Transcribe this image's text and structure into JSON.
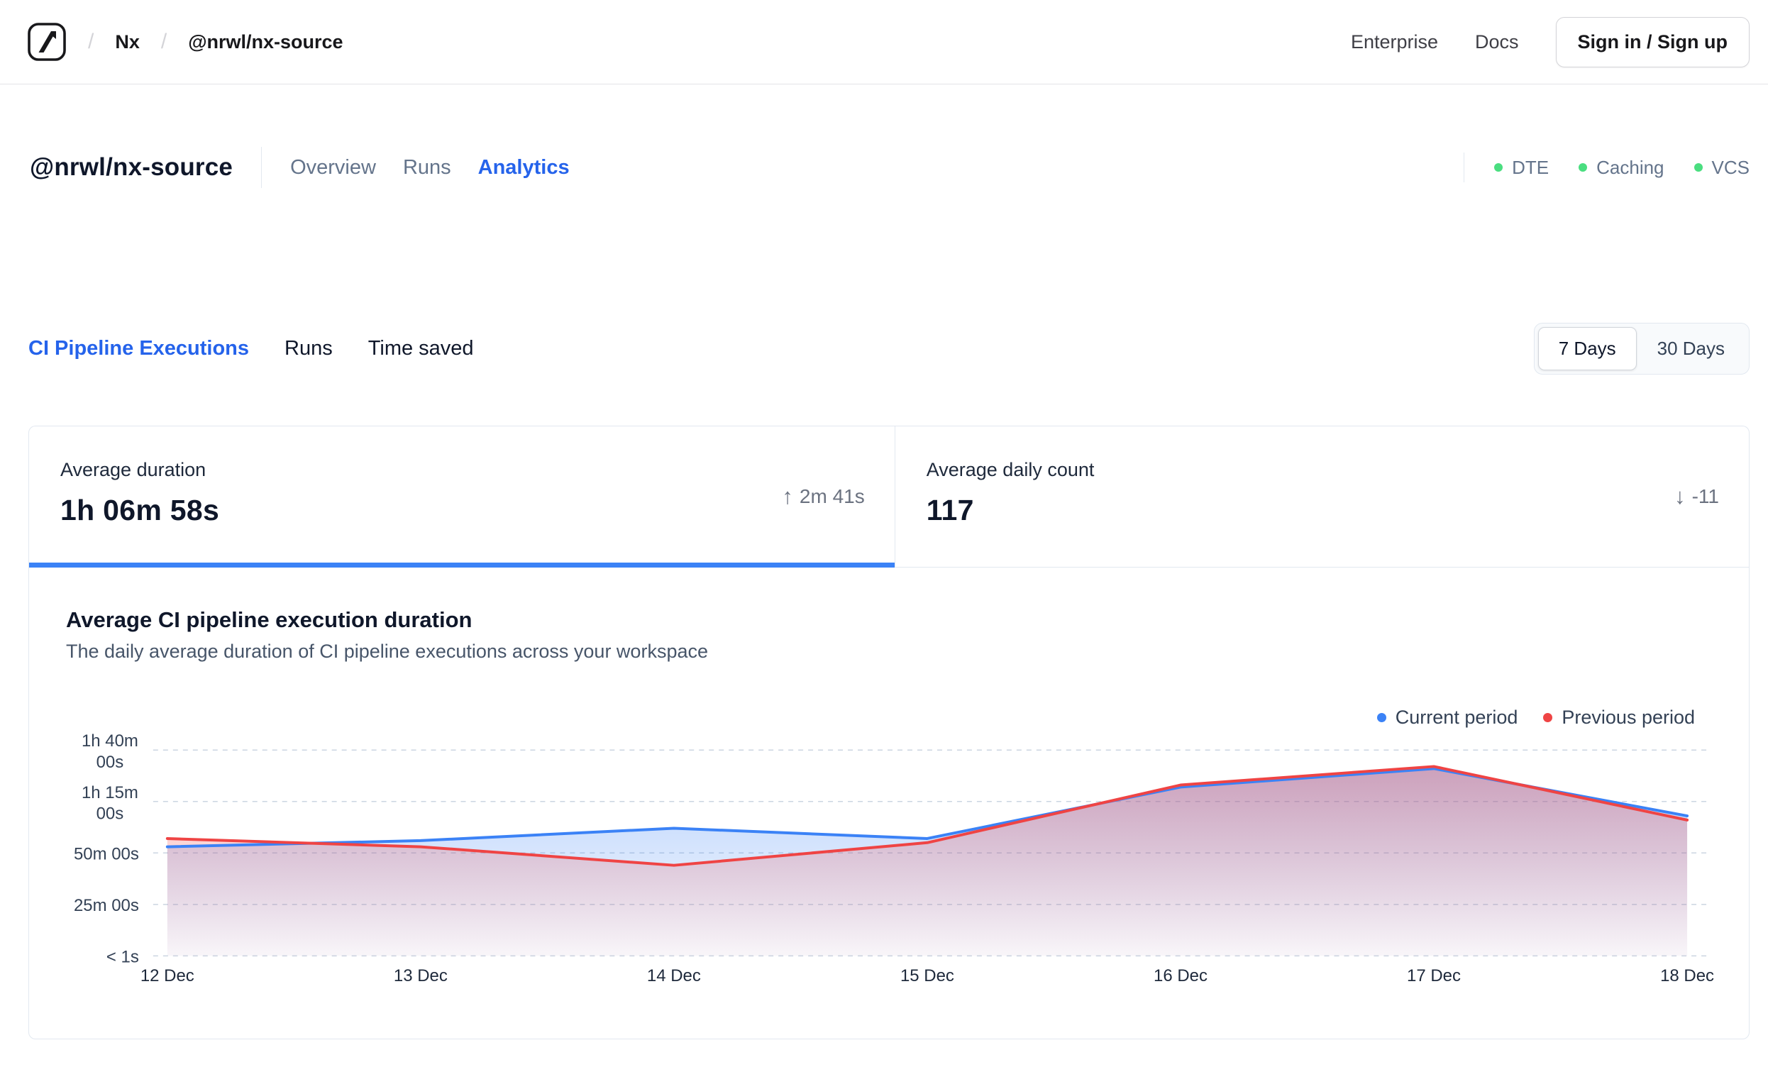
{
  "navbar": {
    "breadcrumb": {
      "separator": "/",
      "org": "Nx",
      "repo": "@nrwl/nx-source"
    },
    "links": {
      "enterprise": "Enterprise",
      "docs": "Docs"
    },
    "sign_in_button": "Sign in / Sign up"
  },
  "workspace_header": {
    "title": "@nrwl/nx-source",
    "tabs": [
      {
        "label": "Overview",
        "active": false
      },
      {
        "label": "Runs",
        "active": false
      },
      {
        "label": "Analytics",
        "active": true
      }
    ],
    "statuses": [
      {
        "label": "DTE"
      },
      {
        "label": "Caching"
      },
      {
        "label": "VCS"
      }
    ],
    "status_dot_color": "#4ade80"
  },
  "analytics_tabs": [
    {
      "label": "CI Pipeline Executions",
      "active": true
    },
    {
      "label": "Runs",
      "active": false
    },
    {
      "label": "Time saved",
      "active": false
    }
  ],
  "range_toggle": {
    "options": [
      {
        "label": "7 Days",
        "active": true
      },
      {
        "label": "30 Days",
        "active": false
      }
    ]
  },
  "stat_cards": [
    {
      "label": "Average duration",
      "value": "1h 06m 58s",
      "delta": "2m 41s",
      "delta_arrow": "↑",
      "delta_direction": "up",
      "active": true
    },
    {
      "label": "Average daily count",
      "value": "117",
      "delta": "-11",
      "delta_arrow": "↓",
      "delta_direction": "down",
      "active": false
    }
  ],
  "chart_card": {
    "title": "Average CI pipeline execution duration",
    "subtitle": "The daily average duration of CI pipeline executions across your workspace"
  },
  "chart_data": {
    "type": "line",
    "title": "Average CI pipeline execution duration",
    "x": [
      "12 Dec",
      "13 Dec",
      "14 Dec",
      "15 Dec",
      "16 Dec",
      "17 Dec",
      "18 Dec"
    ],
    "unit": "minutes",
    "series": [
      {
        "name": "Current period",
        "color": "#3b82f6",
        "values": [
          53,
          56,
          62,
          57,
          82,
          91,
          68
        ]
      },
      {
        "name": "Previous period",
        "color": "#ef4444",
        "values": [
          57,
          53,
          44,
          55,
          83,
          92,
          66
        ]
      }
    ],
    "ylim": [
      0,
      100
    ],
    "yticks": [
      {
        "value": 0,
        "lines": [
          "< 1s"
        ]
      },
      {
        "value": 25,
        "lines": [
          "25m 00s"
        ]
      },
      {
        "value": 50,
        "lines": [
          "50m 00s"
        ]
      },
      {
        "value": 75,
        "lines": [
          "1h 15m",
          "00s"
        ]
      },
      {
        "value": 100,
        "lines": [
          "1h 40m",
          "00s"
        ]
      }
    ],
    "grid": "dashed-horizontal",
    "legend_position": "top-right",
    "area_fill": true
  }
}
